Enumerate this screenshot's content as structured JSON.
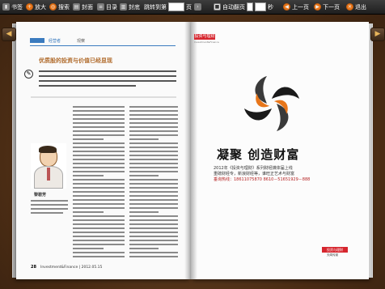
{
  "toolbar": {
    "bookmark": "书签",
    "zoom_in": "放大",
    "search": "搜索",
    "cover": "封面",
    "toc": "目录",
    "back_cover": "封底",
    "goto_label": "跳转到第",
    "goto_unit": "页",
    "auto_flip": "自动翻页",
    "seconds": "秒",
    "prev": "上一页",
    "next": "下一页",
    "exit": "退出"
  },
  "left_page": {
    "section_tag": "经营者",
    "section_sub": "观察",
    "title": "优质股的投资与价值已经显现",
    "person_name": "黎碧芳",
    "footer_page": "28",
    "footer_text": "Investment&Finance | 2012.05.15"
  },
  "right_page": {
    "brand": "投资与理财",
    "brand_sub": "Investment&Finance",
    "slogan": "凝聚  创造财富",
    "ad_line1": "2012年《投资与理财》系列财经媒体届上线",
    "ad_line2": "重磅财经专，新浪财经等，谁旺正艺术与财富",
    "ad_line3": "垂询热线：18611075870  8610－51651929－888",
    "footer_brand": "投资与理财",
    "footer_sub": "天闻传媒"
  },
  "colors": {
    "accent_orange": "#e8761a",
    "brand_red": "#d6262e",
    "header_blue": "#3a7bbf"
  },
  "icons": [
    "bookmark-icon",
    "zoom-in-icon",
    "search-icon",
    "cover-icon",
    "toc-icon",
    "back-cover-icon",
    "goto-icon",
    "auto-flip-icon",
    "prev-icon",
    "next-icon",
    "exit-icon",
    "left-arrow-icon",
    "right-arrow-icon"
  ]
}
